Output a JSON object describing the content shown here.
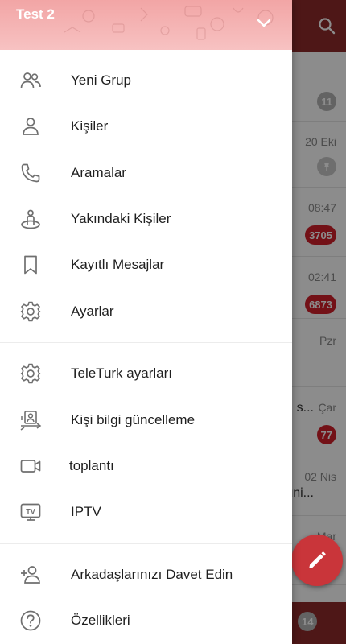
{
  "drawer": {
    "account_name": "Test 2",
    "toggle_icon": "chevron-down-icon",
    "sections": [
      [
        {
          "label": "Yeni Grup",
          "icon": "group-icon"
        },
        {
          "label": "Kişiler",
          "icon": "person-icon"
        },
        {
          "label": "Aramalar",
          "icon": "phone-icon"
        },
        {
          "label": "Yakındaki Kişiler",
          "icon": "nearby-people-icon"
        },
        {
          "label": "Kayıtlı Mesajlar",
          "icon": "bookmark-icon"
        },
        {
          "label": "Ayarlar",
          "icon": "gear-icon"
        }
      ],
      [
        {
          "label": "TeleTurk ayarları",
          "icon": "gear-icon"
        },
        {
          "label": "Kişi bilgi güncelleme",
          "icon": "contact-sync-icon"
        },
        {
          "label": "toplantı",
          "icon": "video-camera-icon"
        },
        {
          "label": "IPTV",
          "icon": "tv-icon"
        }
      ],
      [
        {
          "label": "Arkadaşlarınızı Davet Edin",
          "icon": "add-person-icon"
        },
        {
          "label": "Özellikleri",
          "icon": "help-icon"
        }
      ]
    ]
  },
  "background": {
    "rows": [
      {
        "time": "",
        "badge": "11",
        "badge_style": "grey"
      },
      {
        "time": "20 Eki",
        "badge": "",
        "pinned": true
      },
      {
        "time": "08:47",
        "badge": "3705",
        "badge_style": "red"
      },
      {
        "time": "02:41",
        "badge": "6873",
        "badge_style": "red"
      },
      {
        "time": "Pzr",
        "badge": ""
      },
      {
        "time": "Çar",
        "badge": "77",
        "badge_style": "red",
        "snippet": "s..."
      },
      {
        "time": "02 Nis",
        "badge": "",
        "snippet": "uni..."
      },
      {
        "time": "Mar",
        "badge": ""
      }
    ],
    "bottom_badge": "14"
  },
  "colors": {
    "header_red": "#8e2a2a",
    "badge_red": "#d11f2a",
    "drawer_header_pink": "#f4b3b3",
    "fab_red": "#c9353a"
  }
}
